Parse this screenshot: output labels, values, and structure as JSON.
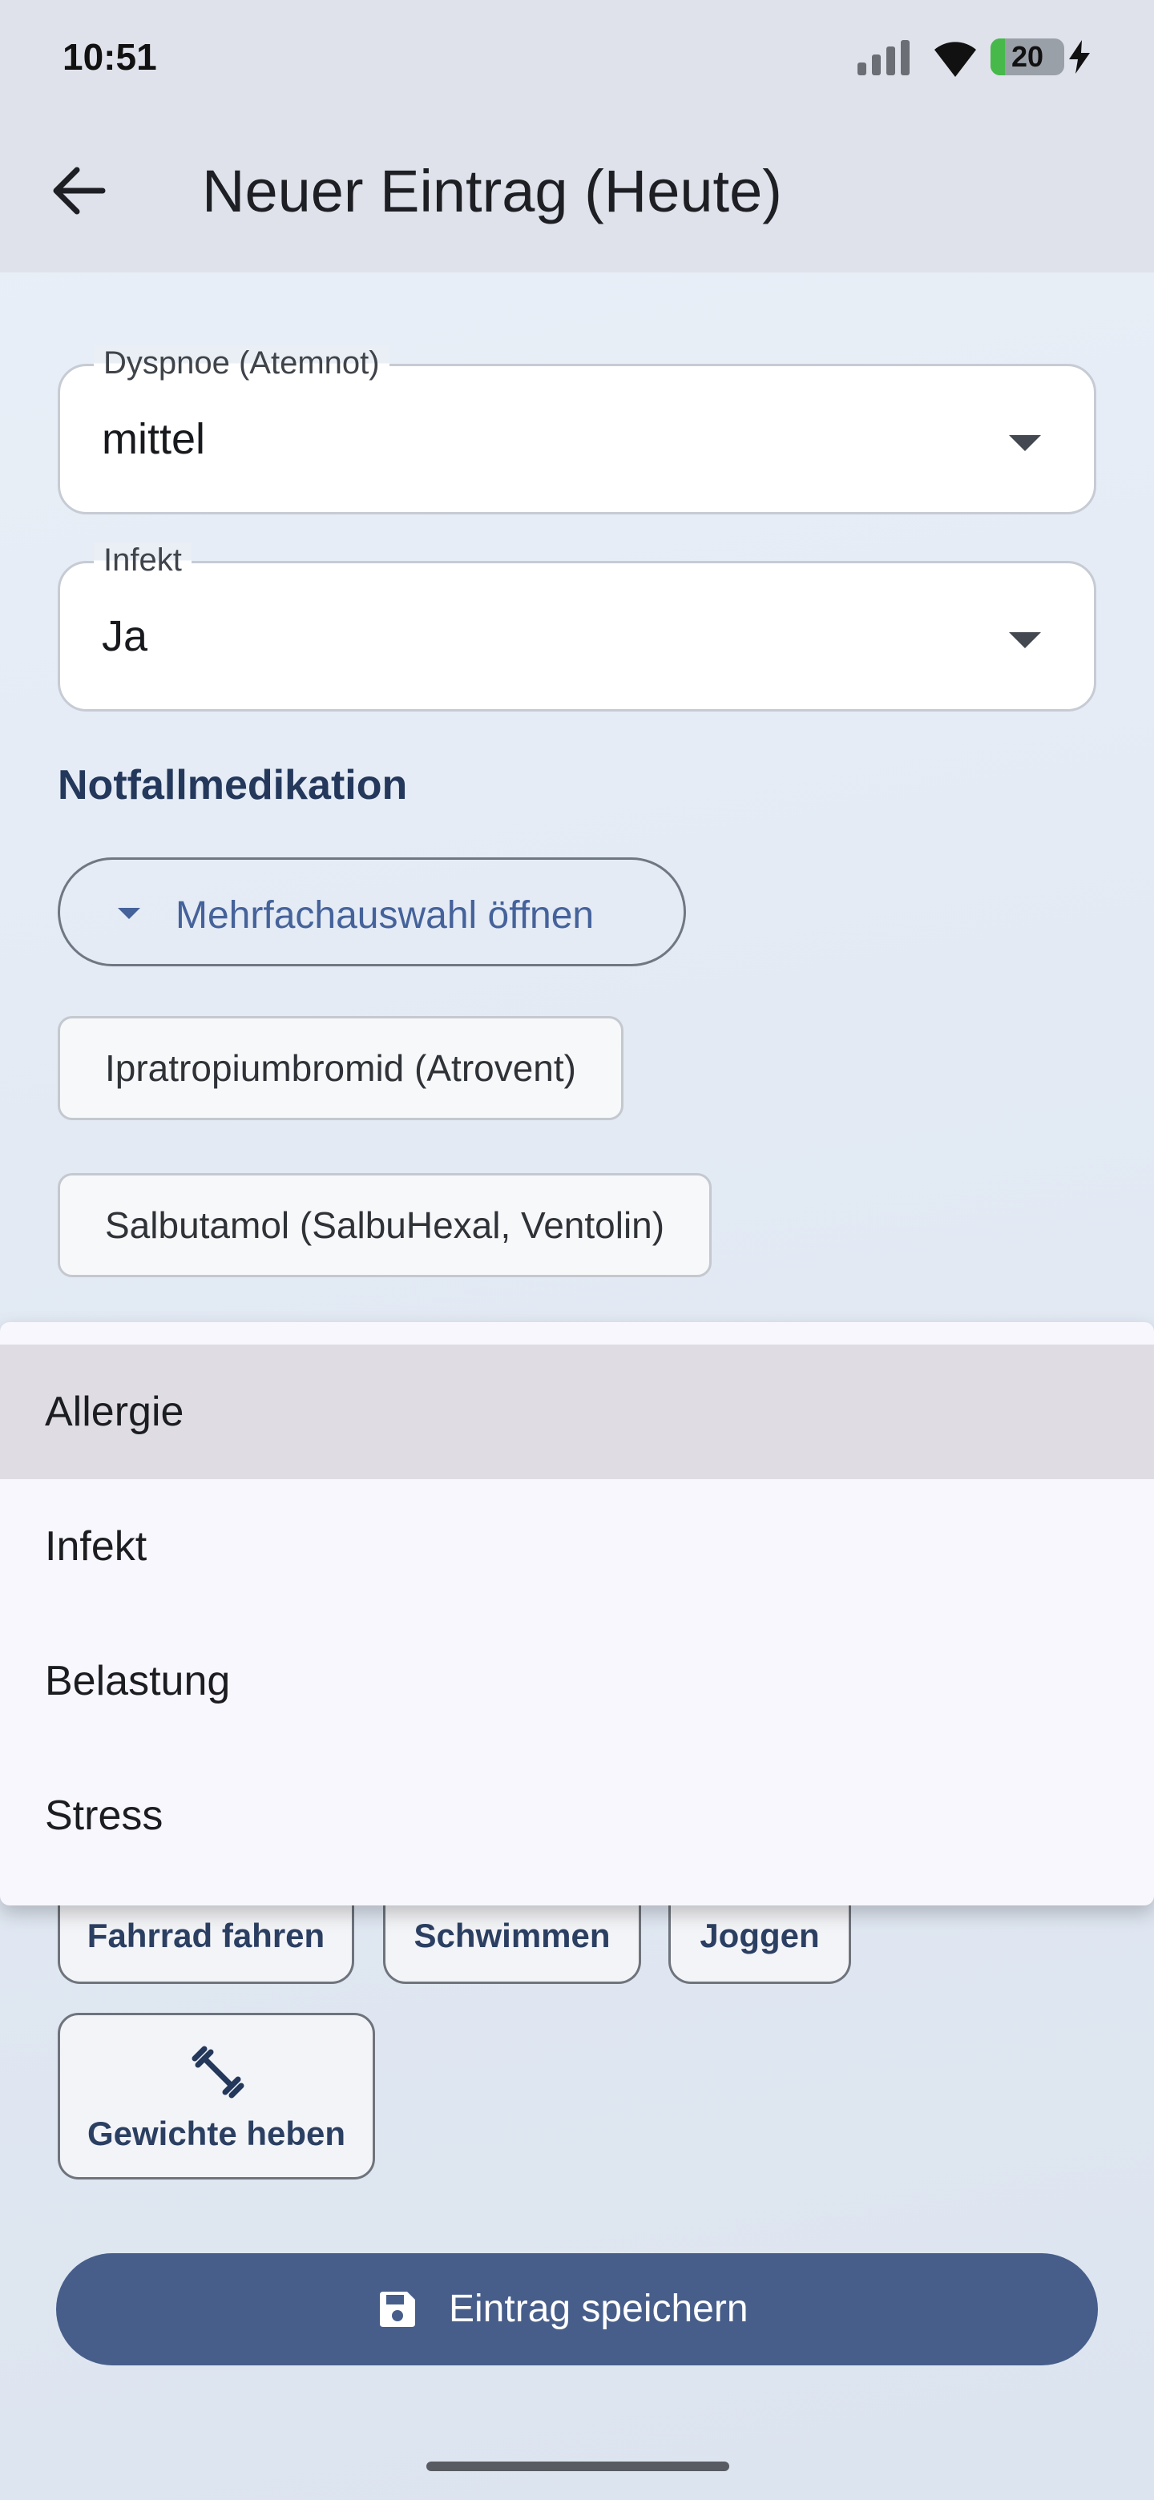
{
  "status": {
    "time": "10:51",
    "battery": "20",
    "battery_level": 0.2
  },
  "header": {
    "title": "Neuer Eintrag (Heute)"
  },
  "fields": [
    {
      "label": "Dyspnoe (Atemnot)",
      "value": "mittel"
    },
    {
      "label": "Infekt",
      "value": "Ja"
    }
  ],
  "emergency": {
    "title": "Notfallmedikation",
    "multiselect_label": "Mehrfachauswahl öffnen",
    "chips": [
      "Ipratropiumbromid (Atrovent)",
      "Salbutamol (SalbuHexal, Ventolin)"
    ]
  },
  "dropdown": {
    "options": [
      "Allergie",
      "Infekt",
      "Belastung",
      "Stress"
    ],
    "selected": "Allergie"
  },
  "activities": {
    "items": [
      "Fahrrad fahren",
      "Schwimmen",
      "Joggen"
    ],
    "weights": {
      "label": "Gewichte heben",
      "icon": "dumbbell-icon"
    }
  },
  "actions": {
    "save_label": "Eintrag speichern",
    "save_icon": "save-icon"
  },
  "colors": {
    "accent": "#475e8b",
    "section_title": "#24385c",
    "link": "#45629a"
  }
}
